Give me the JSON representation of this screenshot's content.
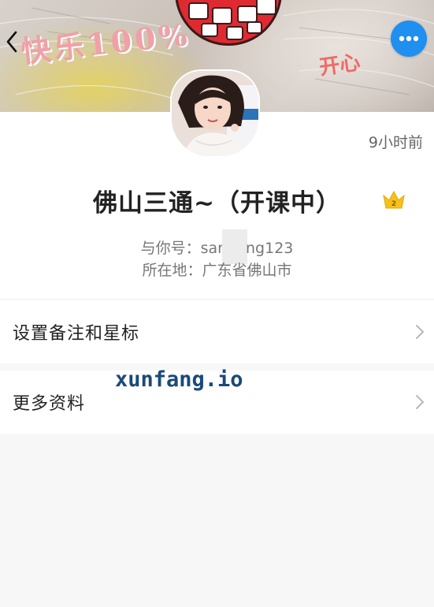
{
  "cover": {
    "doodle_left": "快乐100%",
    "doodle_right": "开心",
    "back_icon": "chevron-left-icon",
    "more_icon": "more-dots-icon",
    "more_color": "#1f8ff0"
  },
  "profile": {
    "last_active": "9小时前",
    "nickname": "佛山三通~（开课中）",
    "crown_level": "2",
    "wechat_label": "与你号：",
    "wechat_prefix": "sar",
    "wechat_suffix": "ng123",
    "region_label": "所在地：",
    "region_value": "广东省佛山市"
  },
  "rows": [
    {
      "label": "设置备注和星标",
      "icon": "chevron-right-icon"
    },
    {
      "label": "更多资料",
      "icon": "chevron-right-icon"
    }
  ],
  "watermark": "xunfang.io"
}
